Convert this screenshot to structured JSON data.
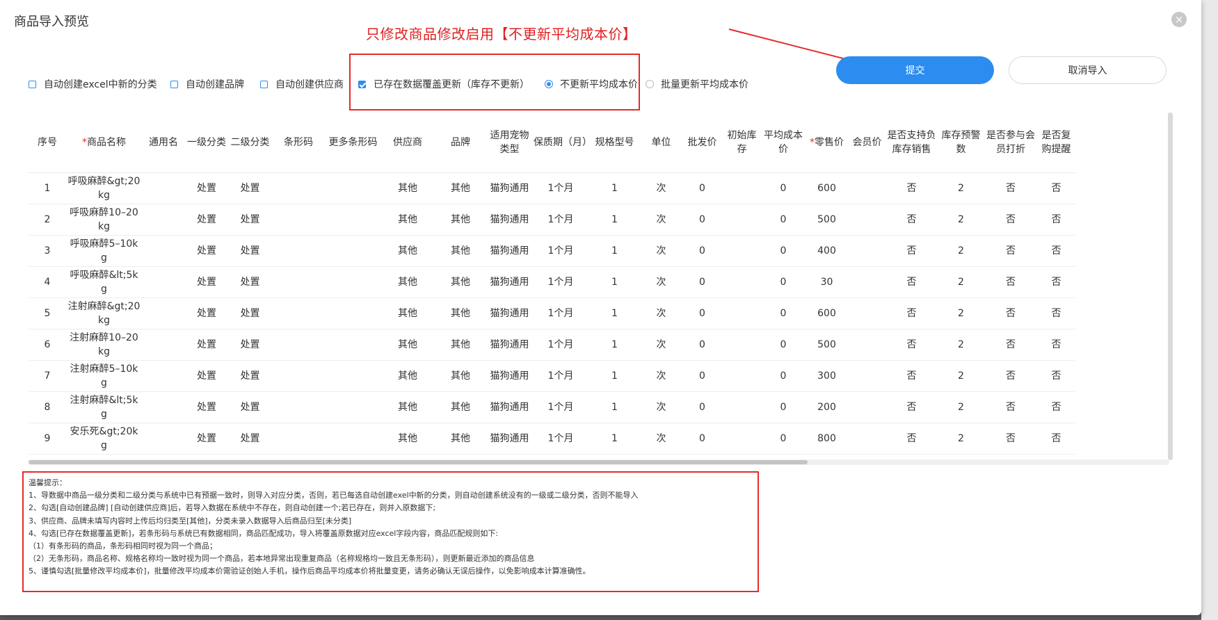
{
  "dialog": {
    "title": "商品导入预览",
    "close_glyph": "×"
  },
  "annotation": {
    "text": "只修改商品修改启用【不更新平均成本价】",
    "color": "#e02020"
  },
  "options": {
    "auto_category": "自动创建excel中新的分类",
    "auto_brand": "自动创建品牌",
    "auto_supplier": "自动创建供应商",
    "overwrite_existing": "已存在数据覆盖更新（库存不更新）",
    "no_update_cost": "不更新平均成本价",
    "batch_update_cost": "批量更新平均成本价",
    "state": {
      "auto_category": false,
      "auto_brand": false,
      "auto_supplier": false,
      "overwrite_existing": true,
      "cost_mode": "no_update_cost"
    }
  },
  "buttons": {
    "submit": "提交",
    "cancel": "取消导入"
  },
  "colors": {
    "primary": "#2d8cf0",
    "annotation_red": "#e42b2b",
    "required_mark": "#f5222d"
  },
  "table": {
    "columns": [
      {
        "key": "idx",
        "label": "序号",
        "required": false
      },
      {
        "key": "name",
        "label": "商品名称",
        "required": true
      },
      {
        "key": "common",
        "label": "通用名",
        "required": false
      },
      {
        "key": "cat1",
        "label": "一级分类",
        "required": false
      },
      {
        "key": "cat2",
        "label": "二级分类",
        "required": false
      },
      {
        "key": "barcode",
        "label": "条形码",
        "required": false
      },
      {
        "key": "more_barcode",
        "label": "更多条形码",
        "required": false
      },
      {
        "key": "supplier",
        "label": "供应商",
        "required": false
      },
      {
        "key": "brand",
        "label": "品牌",
        "required": false
      },
      {
        "key": "pet_type",
        "label": "适用宠物类型",
        "required": false
      },
      {
        "key": "shelf_life",
        "label": "保质期（月）",
        "required": false
      },
      {
        "key": "spec",
        "label": "规格型号",
        "required": false
      },
      {
        "key": "unit",
        "label": "单位",
        "required": false
      },
      {
        "key": "wholesale",
        "label": "批发价",
        "required": false
      },
      {
        "key": "init_stock",
        "label": "初始库存",
        "required": false
      },
      {
        "key": "avg_cost",
        "label": "平均成本价",
        "required": false
      },
      {
        "key": "retail",
        "label": "零售价",
        "required": true
      },
      {
        "key": "member",
        "label": "会员价",
        "required": false
      },
      {
        "key": "neg_stock",
        "label": "是否支持负库存销售",
        "required": false
      },
      {
        "key": "warn",
        "label": "库存预警数",
        "required": false
      },
      {
        "key": "member_disc",
        "label": "是否参与会员打折",
        "required": false
      },
      {
        "key": "repurchase",
        "label": "是否复购提醒",
        "required": false
      }
    ],
    "rows": [
      [
        "1",
        "呼吸麻醉&gt;20kg",
        "",
        "处置",
        "处置",
        "",
        "",
        "其他",
        "其他",
        "猫狗通用",
        "1个月",
        "1",
        "次",
        "0",
        "",
        "0",
        "600",
        "",
        "否",
        "2",
        "否",
        "否"
      ],
      [
        "2",
        "呼吸麻醉10–20kg",
        "",
        "处置",
        "处置",
        "",
        "",
        "其他",
        "其他",
        "猫狗通用",
        "1个月",
        "1",
        "次",
        "0",
        "",
        "0",
        "500",
        "",
        "否",
        "2",
        "否",
        "否"
      ],
      [
        "3",
        "呼吸麻醉5–10kg",
        "",
        "处置",
        "处置",
        "",
        "",
        "其他",
        "其他",
        "猫狗通用",
        "1个月",
        "1",
        "次",
        "0",
        "",
        "0",
        "400",
        "",
        "否",
        "2",
        "否",
        "否"
      ],
      [
        "4",
        "呼吸麻醉&lt;5kg",
        "",
        "处置",
        "处置",
        "",
        "",
        "其他",
        "其他",
        "猫狗通用",
        "1个月",
        "1",
        "次",
        "0",
        "",
        "0",
        "30",
        "",
        "否",
        "2",
        "否",
        "否"
      ],
      [
        "5",
        "注射麻醉&gt;20kg",
        "",
        "处置",
        "处置",
        "",
        "",
        "其他",
        "其他",
        "猫狗通用",
        "1个月",
        "1",
        "次",
        "0",
        "",
        "0",
        "600",
        "",
        "否",
        "2",
        "否",
        "否"
      ],
      [
        "6",
        "注射麻醉10–20kg",
        "",
        "处置",
        "处置",
        "",
        "",
        "其他",
        "其他",
        "猫狗通用",
        "1个月",
        "1",
        "次",
        "0",
        "",
        "0",
        "500",
        "",
        "否",
        "2",
        "否",
        "否"
      ],
      [
        "7",
        "注射麻醉5–10kg",
        "",
        "处置",
        "处置",
        "",
        "",
        "其他",
        "其他",
        "猫狗通用",
        "1个月",
        "1",
        "次",
        "0",
        "",
        "0",
        "300",
        "",
        "否",
        "2",
        "否",
        "否"
      ],
      [
        "8",
        "注射麻醉&lt;5kg",
        "",
        "处置",
        "处置",
        "",
        "",
        "其他",
        "其他",
        "猫狗通用",
        "1个月",
        "1",
        "次",
        "0",
        "",
        "0",
        "200",
        "",
        "否",
        "2",
        "否",
        "否"
      ],
      [
        "9",
        "安乐死&gt;20kg",
        "",
        "处置",
        "处置",
        "",
        "",
        "其他",
        "其他",
        "猫狗通用",
        "1个月",
        "1",
        "次",
        "0",
        "",
        "0",
        "800",
        "",
        "否",
        "2",
        "否",
        "否"
      ]
    ]
  },
  "tips": {
    "title": "温馨提示：",
    "lines": [
      "1、导数据中商品一级分类和二级分类与系统中已有预据一致时，则导入对应分类，否则，若已每选自动创建exel中新的分类，则自动创建系统没有的一级或二级分类，否则不能导入",
      "2、勾选[自动创建品牌] [自动创建供应商]后，若导入数据在系统中不存在，则自动创建一个;若已存在，则并入原数据下;",
      "3、供应商、品牌未填写内容时上传后均归类至[其他]，分类未录入数据导入后商品归至[未分类]",
      "4、勾选[已存在数据覆盖更新]，若条形码与系统已有数据相同，商品匹配成功，导入将覆盖原数据对应excel字段内容，商品匹配规则如下:",
      "（1）有条形码的商品，条形码相同时视为同一个商品；",
      "（2）无条形码，商品名称、规格名称均一致时视为同一个商品，若本地异常出现重复商品（名称规格均一致且无条形码），则更新最近添加的商品信息",
      "5、谨慎勾选[批量修改平均成本价]，批量修改平均成本价需验证创始人手机，操作后商品平均成本价将批量变更，请务必确认无误后操作，以免影响成本计算准确性。"
    ]
  }
}
